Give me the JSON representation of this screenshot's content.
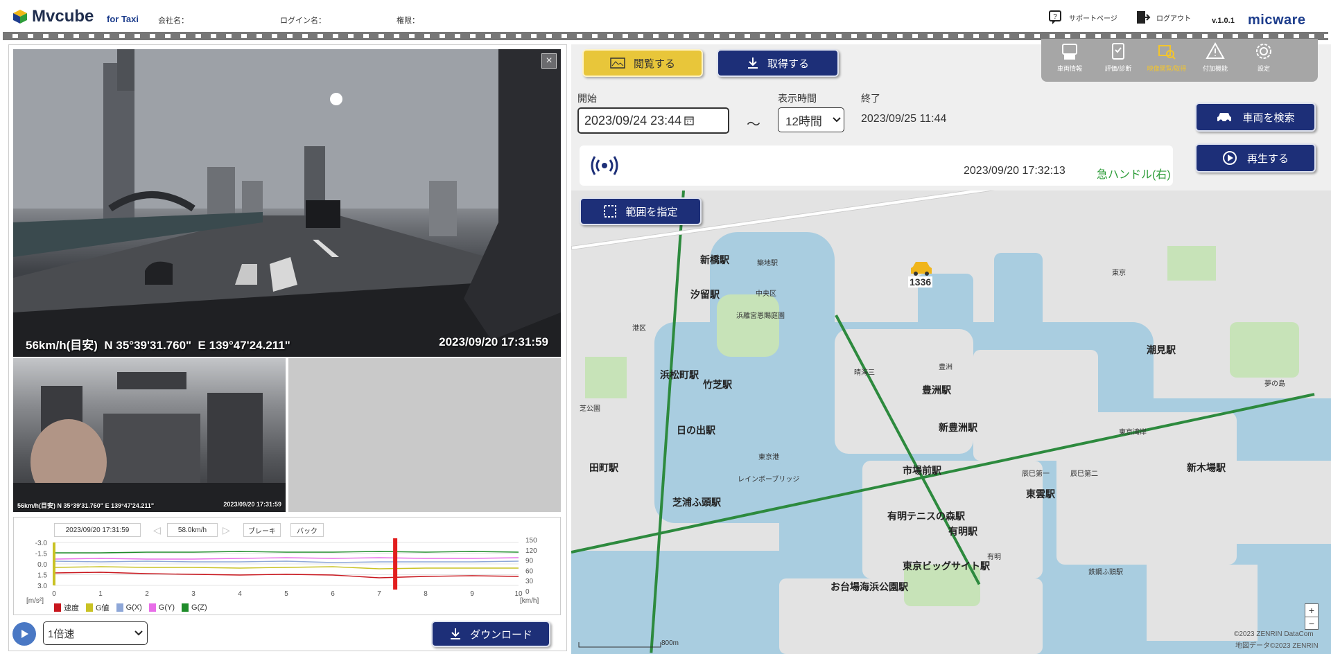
{
  "header": {
    "app_name": "Mvcube",
    "app_sub": "for Taxi",
    "company_label": "会社名：",
    "login_label": "ログイン名：",
    "role_label": "権限：",
    "support_label": "サポートページ",
    "logout_label": "ログアウト",
    "version": "v.1.0.1",
    "brand": "micware"
  },
  "main_video": {
    "speed": "56km/h(目安)",
    "lat": "N 35°39'31.760\"",
    "lon": "E 139°47'24.211\"",
    "timestamp": "2023/09/20 17:31:59"
  },
  "cabin_video": {
    "overlay": "56km/h(目安)  N 35°39'31.760\"  E 139°47'24.211\"",
    "timestamp": "2023/09/20 17:31:59"
  },
  "graph": {
    "timestamp_box": "2023/09/20 17:31:59",
    "speed_box": "58.0km/h",
    "brake_box": "ブレーキ",
    "back_box": "バック",
    "y_left_ticks": [
      "-3.0",
      "-1.5",
      "0.0",
      "1.5",
      "3.0"
    ],
    "y_left_unit": "[m/s²]",
    "y_right_ticks": [
      "150",
      "120",
      "90",
      "60",
      "30",
      "0"
    ],
    "y_right_unit": "[km/h]",
    "x_ticks": [
      "0",
      "1",
      "2",
      "3",
      "4",
      "5",
      "6",
      "7",
      "8",
      "9",
      "10"
    ],
    "legend": [
      {
        "label": "速度",
        "color": "#c8161d"
      },
      {
        "label": "G値",
        "color": "#c9c224"
      },
      {
        "label": "G(X)",
        "color": "#8ea7d8"
      },
      {
        "label": "G(Y)",
        "color": "#e86ee8"
      },
      {
        "label": "G(Z)",
        "color": "#1f8c2a"
      }
    ]
  },
  "playback": {
    "speed_option": "1倍速",
    "download_label": "ダウンロード"
  },
  "toolbar": {
    "view_label": "閲覧する",
    "fetch_label": "取得する"
  },
  "nav": [
    {
      "label": "車両情報",
      "icon": "vehicle-info-icon"
    },
    {
      "label": "評価/診断",
      "icon": "clipboard-check-icon"
    },
    {
      "label": "映像閲覧/取得",
      "icon": "video-search-icon",
      "active": true
    },
    {
      "label": "付加機能",
      "icon": "warning-icon"
    },
    {
      "label": "設定",
      "icon": "gear-icon"
    }
  ],
  "filter": {
    "start_label": "開始",
    "start_value": "2023/09/24 23:44",
    "tilde": "〜",
    "duration_label": "表示時間",
    "duration_value": "12時間",
    "end_label": "終了",
    "end_value": "2023/09/25 11:44",
    "search_vehicle_label": "車両を検索",
    "play_label": "再生する"
  },
  "event": {
    "time": "2023/09/20 17:32:13",
    "type": "急ハンドル(右)"
  },
  "map": {
    "select_area_label": "範囲を指定",
    "vehicle_number": "1336",
    "copyright1": "©2023 ZENRIN DataCom",
    "copyright2": "地図データ©2023 ZENRIN",
    "scale": "800m",
    "stations": [
      "新橋駅",
      "汐留駅",
      "浜松町駅",
      "竹芝駅",
      "日の出駅",
      "田町駅",
      "芝浦ふ頭駅",
      "豊洲駅",
      "新豊洲駅",
      "市場前駅",
      "有明テニスの森駅",
      "有明駅",
      "東京ビッグサイト駅",
      "お台場海浜公園駅",
      "東雲駅",
      "新木場駅",
      "潮見駅"
    ],
    "labels": [
      "中央区",
      "港区",
      "浜離宮恩賜庭園",
      "晴海三",
      "築地駅",
      "芝公園",
      "東京港",
      "レインボーブリッジ",
      "有明",
      "豊洲",
      "辰巳第一",
      "辰巳第二",
      "夢の島",
      "東京湾岸",
      "鉄鋼ふ頭駅",
      "東京"
    ]
  }
}
